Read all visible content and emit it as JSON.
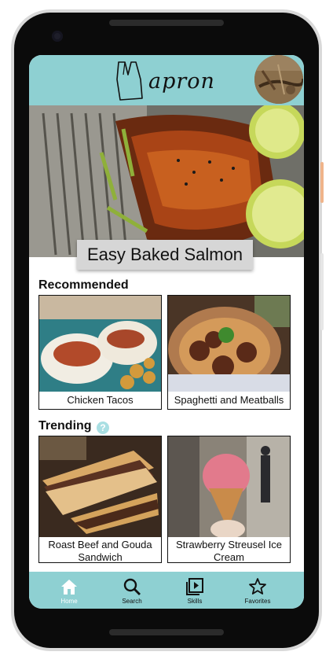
{
  "app": {
    "logo_text": "apron"
  },
  "hero": {
    "title": "Easy Baked Salmon"
  },
  "sections": {
    "recommended": {
      "title": "Recommended",
      "items": [
        {
          "label": "Chicken Tacos"
        },
        {
          "label": "Spaghetti and Meatballs"
        }
      ]
    },
    "trending": {
      "title": "Trending",
      "help_icon": "question-mark-icon",
      "items": [
        {
          "label": "Roast Beef and Gouda Sandwich"
        },
        {
          "label": "Strawberry Streusel Ice Cream"
        }
      ]
    }
  },
  "bottom_nav": [
    {
      "label": "Home",
      "icon": "home-icon",
      "active": true
    },
    {
      "label": "Search",
      "icon": "search-icon",
      "active": false
    },
    {
      "label": "Skills",
      "icon": "play-video-icon",
      "active": false
    },
    {
      "label": "Favorites",
      "icon": "star-icon",
      "active": false
    }
  ],
  "colors": {
    "accent": "#8ed0d2",
    "active_nav_label": "#ffffff"
  }
}
